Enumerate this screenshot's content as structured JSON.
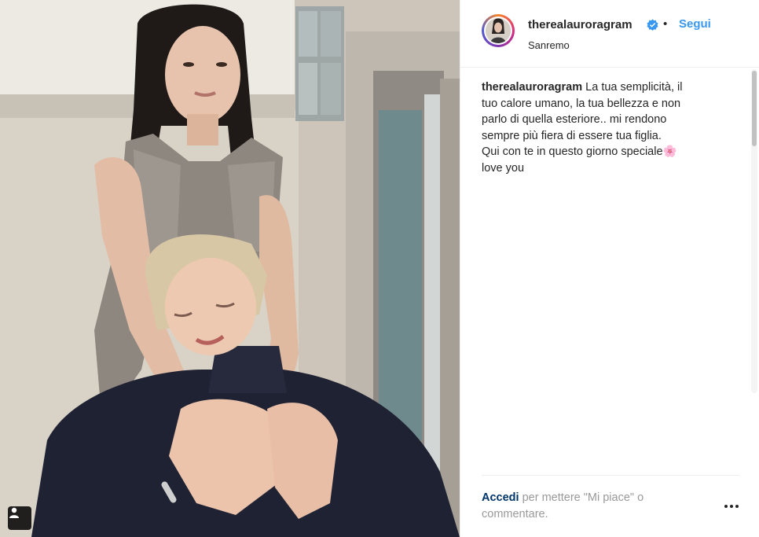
{
  "post": {
    "image_alt": "",
    "tag_icon": "person-tag-icon"
  },
  "header": {
    "username": "therealauroragram",
    "verified_icon": "verified-badge-icon",
    "separator": "•",
    "follow_label": "Segui",
    "location": "Sanremo"
  },
  "caption": {
    "username": "therealauroragram",
    "lines": [
      "La tua semplicità, il",
      "tuo calore umano, la tua bellezza e non",
      "parlo di quella esteriore.. mi rendono",
      "sempre più fiera di essere tua figlia.",
      "Qui con te in questo giorno speciale🌸",
      "love you"
    ]
  },
  "footer": {
    "login_link": "Accedi",
    "login_text": " per mettere \"Mi piace\" o",
    "login_text2": "commentare.",
    "more_icon": "more-options-icon"
  },
  "colors": {
    "link_blue": "#3897f0",
    "login_link": "#003569",
    "muted": "#999999",
    "text": "#262626",
    "verified": "#3897f0"
  }
}
